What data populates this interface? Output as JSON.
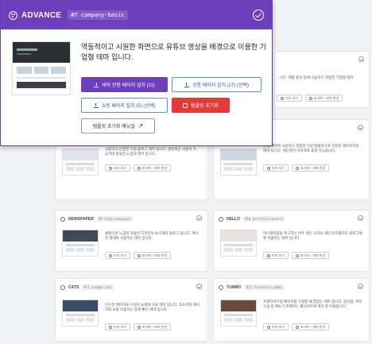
{
  "popup": {
    "title": "ADVANCE",
    "code": "#7 company-basic",
    "description": "역동적이고 시원한 화면으로 유튜브 영상을 배경으로 이용한 기업형 테마 입니다.",
    "buttons": {
      "install_theme": "테마 전용 페이지 설치 (11)",
      "install_common": "공통 페이지 설치 (27) (선택)",
      "install_shop": "쇼핑 페이지 설치 (5) (선택)",
      "reset_template": "템플릿 초기화",
      "reset_manual": "템플릿 초기화 매뉴얼"
    }
  },
  "cards": [
    {
      "title": "",
      "code": "",
      "description": "...니다. 제품 홍보 등에 사용하기 적합한 기업형 테마",
      "btn_preview": "미리 보기",
      "btn_apply": "초기화 + 테마 변경"
    },
    {
      "title": "",
      "code": "",
      "description": "심플하고 단정한 기업 블로그 테마 입니다. 일반적인 사용이 가능하며 깔끔한 느낌의 테마 입니다.",
      "btn_preview": "미리 보기",
      "btn_apply": "초기화 + 테마 변경"
    },
    {
      "title": "",
      "code": "",
      "description": "단색 배경에 사용하기 적합한 기업 템플릿으로 안정된 레이아웃의 테마 입니다. 개인적인 이미지로 표현 가능합니다.",
      "btn_preview": "미리 보기",
      "btn_apply": "초기화 + 테마 변경"
    },
    {
      "title": "NEWSPAPER",
      "code": "#9 blog-newspaper",
      "description": "클래식한 느낌의 적용한 디자인의 뉴스레터 블로그 입니다. 메거진 형태로 사용하는 테마 입니다.",
      "btn_preview": "미리 보기",
      "btn_apply": "초기화 + 테마 변경"
    },
    {
      "title": "HELLO",
      "code": "#10 portfolio-mozart",
      "description": "미니멀리즘을 추구하는 아주 개인 규모의 개인 포트폴리오 블로그에 잘 어울리는 테마 입니다.",
      "btn_preview": "미리 보기",
      "btn_apply": "초기화 + 테마 변경"
    },
    {
      "title": "CATS",
      "code": "#11 voyage-cats",
      "description": "단순한 페이지로 구성된 쇼핑에 이용 테마 입니다. 최소한의 페이지와 쇼핑 이용하는 동에 좋은 테마 입니다.",
      "btn_preview": "미리 보기",
      "btn_apply": "초기화 + 테마 변경"
    },
    {
      "title": "YUMMY",
      "code": "#12 franchise-yummy",
      "description": "프랜차이즈점 페이지를 구성할 때 잘맞는 테마 입니다. 음식점, 서비스업 등 메뉴가 존재하는 웹사이트에 매우 잘 어울립니다.",
      "btn_preview": "미리 보기",
      "btn_apply": "초기화 + 테마 변경"
    }
  ],
  "colors": {
    "accent": "#6e3fbd",
    "danger": "#e53935",
    "outline": "#5b8fd0"
  }
}
